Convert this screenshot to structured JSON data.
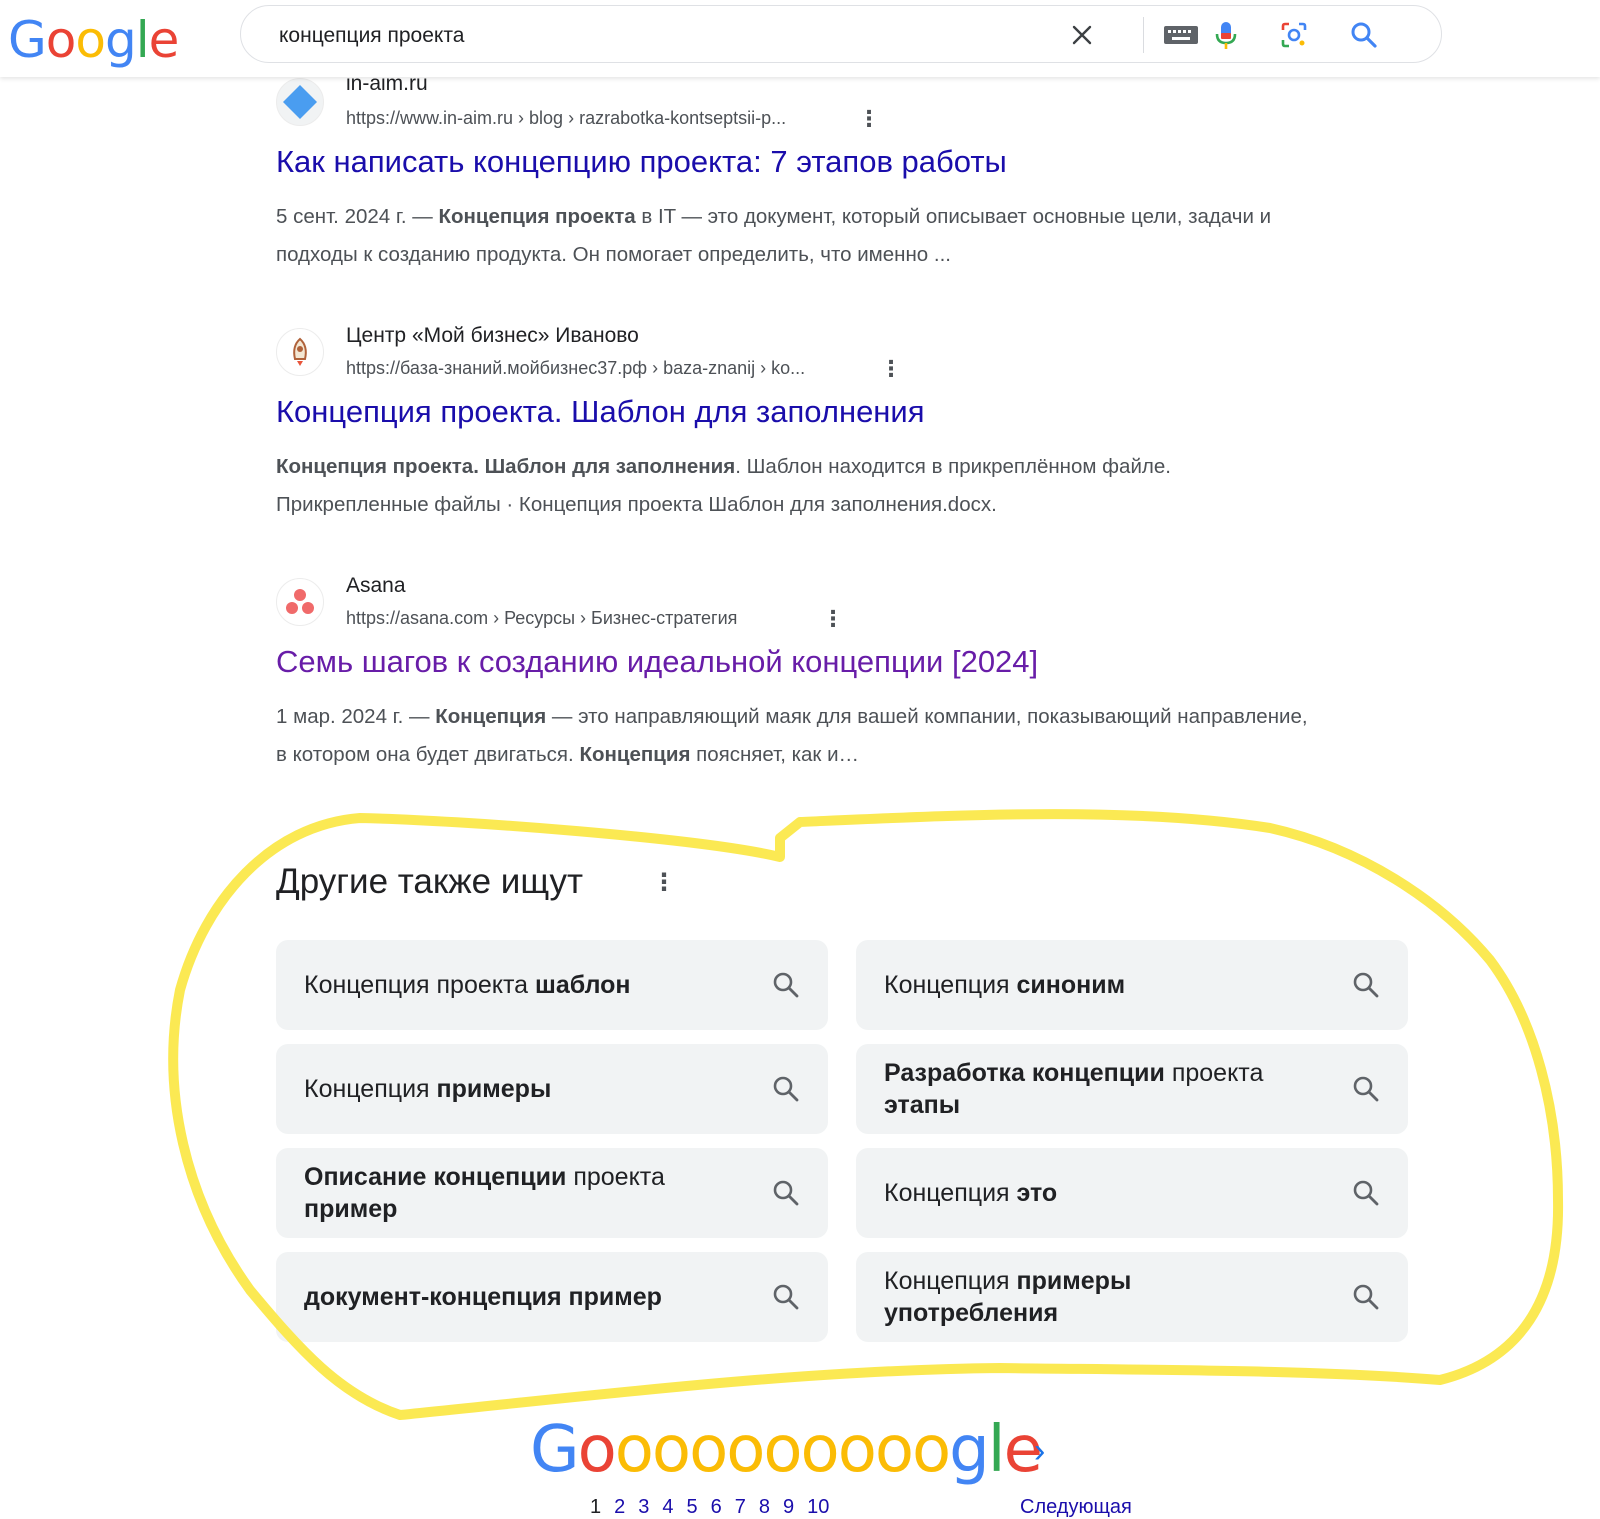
{
  "logo": {
    "letters": [
      "G",
      "o",
      "o",
      "g",
      "l",
      "e"
    ]
  },
  "search": {
    "query": "концепция проекта"
  },
  "results": [
    {
      "site_name": "in-aim.ru",
      "url": "https://www.in-aim.ru › blog › razrabotka-kontseptsii-p...",
      "title": "Как написать концепцию проекта: 7 этапов работы",
      "snippet": {
        "prefix": "5 сент. 2024 г. — ",
        "bold": "Концепция проекта",
        "rest": " в IT — это документ, который описывает основные цели, задачи и подходы к созданию продукта. Он помогает определить, что именно ..."
      }
    },
    {
      "site_name": "Центр «Мой бизнес» Иваново",
      "url": "https://база-знаний.мойбизнес37.рф › baza-znanij › ko...",
      "title": "Концепция проекта. Шаблон для заполнения",
      "snippet": {
        "prefix": "",
        "bold": "Концепция проекта. Шаблон для заполнения",
        "rest": ". Шаблон находится в прикреплённом файле. Прикрепленные файлы · Концепция проекта Шаблон для заполнения.docx."
      }
    },
    {
      "site_name": "Asana",
      "url": "https://asana.com › Ресурсы › Бизнес-стратегия",
      "title": "Семь шагов к созданию идеальной концепции [2024]",
      "snippet": {
        "prefix": "1 мар. 2024 г. — ",
        "bold": "Концепция",
        "rest": " — это направляющий маяк для вашей компании, показывающий направление, в котором она будет двигаться. ",
        "bold2": "Концепция",
        "rest2": " поясняет, как и…"
      }
    }
  ],
  "also_search": {
    "heading": "Другие также ищут",
    "chips": [
      {
        "plain": "Концепция проекта ",
        "bold": "шаблон",
        "tail": ""
      },
      {
        "plain": "Концепция ",
        "bold": "синоним",
        "tail": ""
      },
      {
        "plain": "Концепция ",
        "bold": "примеры",
        "tail": ""
      },
      {
        "plain": "",
        "bold": "Разработка концепции",
        "tail": " проекта",
        "bold2": "этапы"
      },
      {
        "plain": "",
        "bold": "Описание концепции",
        "tail": " проекта",
        "bold2": "пример"
      },
      {
        "plain": "Концепция ",
        "bold": "это",
        "tail": ""
      },
      {
        "plain": "",
        "bold": "документ-концепция пример",
        "tail": ""
      },
      {
        "plain": "Концепция ",
        "bold": "примеры",
        "tail": "",
        "bold2": "употребления"
      }
    ]
  },
  "pagination": {
    "logo": "Goooooooooogle",
    "pages": [
      "1",
      "2",
      "3",
      "4",
      "5",
      "6",
      "7",
      "8",
      "9",
      "10"
    ],
    "next_label": "Следующая"
  },
  "colors": {
    "link": "#1a0dab",
    "visited": "#681da8",
    "highlight": "#fbe84a"
  }
}
